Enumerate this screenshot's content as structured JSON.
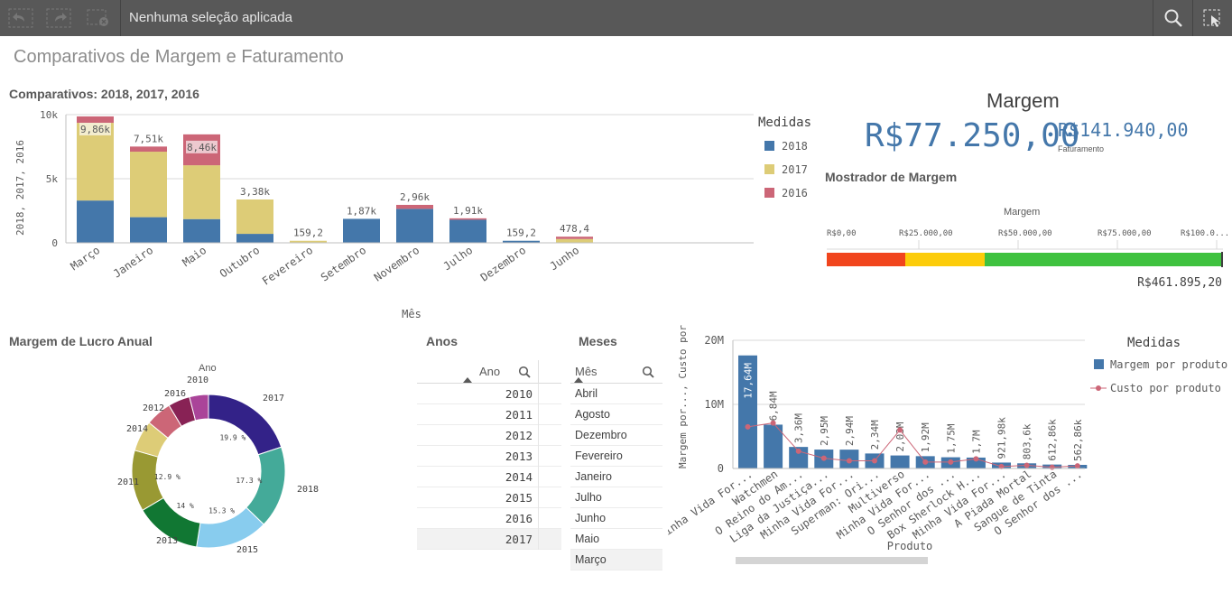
{
  "toolbar": {
    "selection_text": "Nenhuma seleção aplicada",
    "icons": [
      "step-back-icon",
      "step-forward-icon",
      "clear-selections-icon",
      "search-icon",
      "selections-tool-icon"
    ]
  },
  "sheet": {
    "title": "Comparativos de Margem e Faturamento"
  },
  "bar_chart": {
    "title": "Comparativos: 2018, 2017, 2016",
    "y_axis_label": "2018, 2017, 2016",
    "x_axis_label": "Mês",
    "legend_title": "Medidas",
    "legend": [
      "2018",
      "2017",
      "2016"
    ],
    "y_ticks": [
      "10k",
      "5k",
      "0"
    ],
    "colors": {
      "2018": "#4477aa",
      "2017": "#ddcc77",
      "2016": "#cc6677"
    }
  },
  "kpi": {
    "label": "Margem",
    "main_value": "R$77.250,00",
    "secondary_value": "R$141.940,00",
    "secondary_label": "Faturamento"
  },
  "gauge": {
    "title": "Mostrador de Margem",
    "axis_label": "Margem",
    "ticks": [
      "R$0,00",
      "R$25.000,00",
      "R$50.000,00",
      "R$75.000,00",
      "R$100.0..."
    ],
    "value_label": "R$461.895,20",
    "segment_colors": [
      "#f1451d",
      "#fccc0a",
      "#3fc23f"
    ]
  },
  "donut": {
    "title": "Margem de Lucro Anual",
    "dimension_label": "Ano"
  },
  "anos": {
    "title": "Anos",
    "header": "Ano",
    "items": [
      "2010",
      "2011",
      "2012",
      "2013",
      "2014",
      "2015",
      "2016",
      "2017"
    ]
  },
  "meses": {
    "title": "Meses",
    "header": "Mês",
    "items": [
      "Abril",
      "Agosto",
      "Dezembro",
      "Fevereiro",
      "Janeiro",
      "Julho",
      "Junho",
      "Maio",
      "Março"
    ]
  },
  "combo_chart": {
    "y_axis_label": "Margem por..., Custo por...",
    "x_axis_label": "Produto",
    "legend_title": "Medidas",
    "legend": [
      "Margem por produto",
      "Custo por produto"
    ],
    "y_ticks": [
      "20M",
      "10M",
      "0"
    ],
    "colors": {
      "bar": "#4477aa",
      "line": "#cc6677"
    }
  },
  "chart_data": [
    {
      "type": "bar",
      "title": "Comparativos: 2018, 2017, 2016",
      "ylabel": "2018, 2017, 2016",
      "xlabel": "Mês",
      "ylim": [
        0,
        10000
      ],
      "categories": [
        "Março",
        "Janeiro",
        "Maio",
        "Outubro",
        "Fevereiro",
        "Setembro",
        "Novembro",
        "Julho",
        "Dezembro",
        "Junho"
      ],
      "series": [
        {
          "name": "2018",
          "values": [
            3300,
            2000,
            1850,
            700,
            0,
            1870,
            2650,
            1800,
            159.2,
            0
          ]
        },
        {
          "name": "2017",
          "values": [
            6060,
            5110,
            4200,
            2680,
            159.2,
            0,
            0,
            0,
            0,
            300
          ]
        },
        {
          "name": "2016",
          "values": [
            500,
            400,
            2410,
            0,
            0,
            0,
            310,
            110,
            0,
            178.4
          ]
        }
      ],
      "totals_labels": [
        "9,86k",
        "7,51k",
        "8,46k",
        "3,38k",
        "159,2",
        "1,87k",
        "2,96k",
        "1,91k",
        "159,2",
        "478,4"
      ],
      "grid": true,
      "legend_position": "right"
    },
    {
      "type": "pie",
      "title": "Margem de Lucro Anual",
      "categories": [
        "2017",
        "2018",
        "2015",
        "2013",
        "2011",
        "2014",
        "2012",
        "2016",
        "2010"
      ],
      "values": [
        19.9,
        17.3,
        15.3,
        14,
        12.9,
        6.5,
        5.5,
        4.6,
        4.0
      ],
      "labels": [
        "19.9 %",
        "17.3 %",
        "15.3 %",
        "14 %",
        "12.9 %",
        "",
        "",
        "",
        ""
      ],
      "colors": [
        "#332288",
        "#44aa99",
        "#88ccee",
        "#117733",
        "#999933",
        "#ddcc77",
        "#cc6677",
        "#882255",
        "#aa4499"
      ]
    },
    {
      "type": "bar",
      "xlabel": "Produto",
      "ylabel": "Margem por..., Custo por...",
      "ylim": [
        0,
        20000000
      ],
      "categories": [
        "Minha Vida For...",
        "Watchmen",
        "O Reino do Am...",
        "Liga da Justiça...",
        "Minha Vida For...",
        "Superman: Ori...",
        "Multiverso",
        "Minha Vida For...",
        "O Senhor dos ...",
        "Box Sherlock H...",
        "Minha Vida For...",
        "A Piada Mortal",
        "Sangue de Tinta",
        "O Senhor dos ..."
      ],
      "series": [
        {
          "name": "Margem por produto",
          "values": [
            17640000,
            6840000,
            3360000,
            2950000,
            2940000,
            2340000,
            2030000,
            1920000,
            1750000,
            1700000,
            921980,
            803600,
            612860,
            562860
          ]
        },
        {
          "name": "Custo por produto",
          "values": [
            6500000,
            7100000,
            2700000,
            1600000,
            1200000,
            1200000,
            6000000,
            1000000,
            1000000,
            1500000,
            300000,
            500000,
            200000,
            400000
          ]
        }
      ],
      "value_labels": [
        "17,64M",
        "6,84M",
        "3,36M",
        "2,95M",
        "2,94M",
        "2,34M",
        "2,03M",
        "1,92M",
        "1,75M",
        "1,7M",
        "921,98k",
        "803,6k",
        "612,86k",
        "562,86k"
      ],
      "grid": true,
      "legend_position": "right"
    }
  ]
}
